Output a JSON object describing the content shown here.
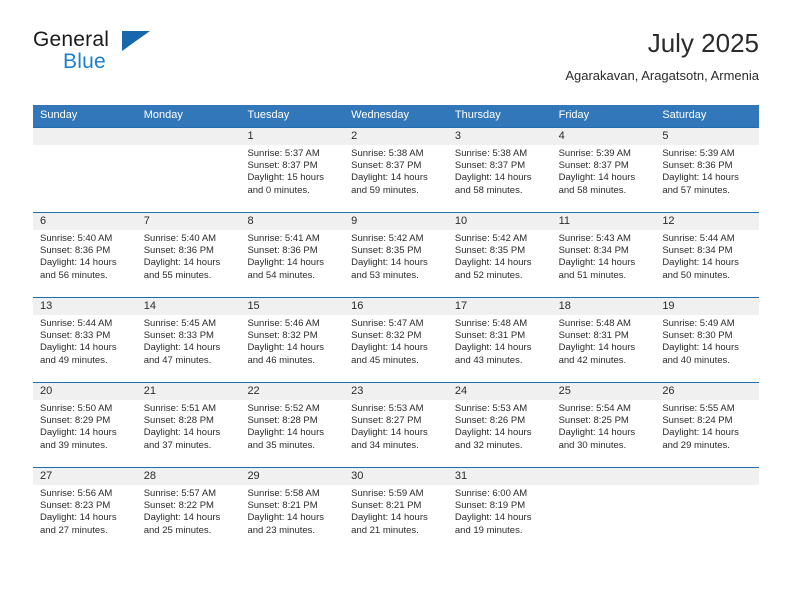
{
  "brand": {
    "name_top": "General",
    "name_bottom": "Blue",
    "triangle_color": "#1866ab",
    "blue_color": "#1d7fd0"
  },
  "header": {
    "title": "July 2025",
    "subtitle": "Agarakavan, Aragatsotn, Armenia"
  },
  "theme": {
    "header_blue": "#3277b9",
    "row_border_blue": "#1f6cb0",
    "day_band_gray": "#f0f0f0"
  },
  "calendar": {
    "weekdays": [
      "Sunday",
      "Monday",
      "Tuesday",
      "Wednesday",
      "Thursday",
      "Friday",
      "Saturday"
    ],
    "weeks": [
      [
        {
          "day": "",
          "sunrise": "",
          "sunset": "",
          "daylight_1": "",
          "daylight_2": ""
        },
        {
          "day": "",
          "sunrise": "",
          "sunset": "",
          "daylight_1": "",
          "daylight_2": ""
        },
        {
          "day": "1",
          "sunrise": "Sunrise: 5:37 AM",
          "sunset": "Sunset: 8:37 PM",
          "daylight_1": "Daylight: 15 hours",
          "daylight_2": "and 0 minutes."
        },
        {
          "day": "2",
          "sunrise": "Sunrise: 5:38 AM",
          "sunset": "Sunset: 8:37 PM",
          "daylight_1": "Daylight: 14 hours",
          "daylight_2": "and 59 minutes."
        },
        {
          "day": "3",
          "sunrise": "Sunrise: 5:38 AM",
          "sunset": "Sunset: 8:37 PM",
          "daylight_1": "Daylight: 14 hours",
          "daylight_2": "and 58 minutes."
        },
        {
          "day": "4",
          "sunrise": "Sunrise: 5:39 AM",
          "sunset": "Sunset: 8:37 PM",
          "daylight_1": "Daylight: 14 hours",
          "daylight_2": "and 58 minutes."
        },
        {
          "day": "5",
          "sunrise": "Sunrise: 5:39 AM",
          "sunset": "Sunset: 8:36 PM",
          "daylight_1": "Daylight: 14 hours",
          "daylight_2": "and 57 minutes."
        }
      ],
      [
        {
          "day": "6",
          "sunrise": "Sunrise: 5:40 AM",
          "sunset": "Sunset: 8:36 PM",
          "daylight_1": "Daylight: 14 hours",
          "daylight_2": "and 56 minutes."
        },
        {
          "day": "7",
          "sunrise": "Sunrise: 5:40 AM",
          "sunset": "Sunset: 8:36 PM",
          "daylight_1": "Daylight: 14 hours",
          "daylight_2": "and 55 minutes."
        },
        {
          "day": "8",
          "sunrise": "Sunrise: 5:41 AM",
          "sunset": "Sunset: 8:36 PM",
          "daylight_1": "Daylight: 14 hours",
          "daylight_2": "and 54 minutes."
        },
        {
          "day": "9",
          "sunrise": "Sunrise: 5:42 AM",
          "sunset": "Sunset: 8:35 PM",
          "daylight_1": "Daylight: 14 hours",
          "daylight_2": "and 53 minutes."
        },
        {
          "day": "10",
          "sunrise": "Sunrise: 5:42 AM",
          "sunset": "Sunset: 8:35 PM",
          "daylight_1": "Daylight: 14 hours",
          "daylight_2": "and 52 minutes."
        },
        {
          "day": "11",
          "sunrise": "Sunrise: 5:43 AM",
          "sunset": "Sunset: 8:34 PM",
          "daylight_1": "Daylight: 14 hours",
          "daylight_2": "and 51 minutes."
        },
        {
          "day": "12",
          "sunrise": "Sunrise: 5:44 AM",
          "sunset": "Sunset: 8:34 PM",
          "daylight_1": "Daylight: 14 hours",
          "daylight_2": "and 50 minutes."
        }
      ],
      [
        {
          "day": "13",
          "sunrise": "Sunrise: 5:44 AM",
          "sunset": "Sunset: 8:33 PM",
          "daylight_1": "Daylight: 14 hours",
          "daylight_2": "and 49 minutes."
        },
        {
          "day": "14",
          "sunrise": "Sunrise: 5:45 AM",
          "sunset": "Sunset: 8:33 PM",
          "daylight_1": "Daylight: 14 hours",
          "daylight_2": "and 47 minutes."
        },
        {
          "day": "15",
          "sunrise": "Sunrise: 5:46 AM",
          "sunset": "Sunset: 8:32 PM",
          "daylight_1": "Daylight: 14 hours",
          "daylight_2": "and 46 minutes."
        },
        {
          "day": "16",
          "sunrise": "Sunrise: 5:47 AM",
          "sunset": "Sunset: 8:32 PM",
          "daylight_1": "Daylight: 14 hours",
          "daylight_2": "and 45 minutes."
        },
        {
          "day": "17",
          "sunrise": "Sunrise: 5:48 AM",
          "sunset": "Sunset: 8:31 PM",
          "daylight_1": "Daylight: 14 hours",
          "daylight_2": "and 43 minutes."
        },
        {
          "day": "18",
          "sunrise": "Sunrise: 5:48 AM",
          "sunset": "Sunset: 8:31 PM",
          "daylight_1": "Daylight: 14 hours",
          "daylight_2": "and 42 minutes."
        },
        {
          "day": "19",
          "sunrise": "Sunrise: 5:49 AM",
          "sunset": "Sunset: 8:30 PM",
          "daylight_1": "Daylight: 14 hours",
          "daylight_2": "and 40 minutes."
        }
      ],
      [
        {
          "day": "20",
          "sunrise": "Sunrise: 5:50 AM",
          "sunset": "Sunset: 8:29 PM",
          "daylight_1": "Daylight: 14 hours",
          "daylight_2": "and 39 minutes."
        },
        {
          "day": "21",
          "sunrise": "Sunrise: 5:51 AM",
          "sunset": "Sunset: 8:28 PM",
          "daylight_1": "Daylight: 14 hours",
          "daylight_2": "and 37 minutes."
        },
        {
          "day": "22",
          "sunrise": "Sunrise: 5:52 AM",
          "sunset": "Sunset: 8:28 PM",
          "daylight_1": "Daylight: 14 hours",
          "daylight_2": "and 35 minutes."
        },
        {
          "day": "23",
          "sunrise": "Sunrise: 5:53 AM",
          "sunset": "Sunset: 8:27 PM",
          "daylight_1": "Daylight: 14 hours",
          "daylight_2": "and 34 minutes."
        },
        {
          "day": "24",
          "sunrise": "Sunrise: 5:53 AM",
          "sunset": "Sunset: 8:26 PM",
          "daylight_1": "Daylight: 14 hours",
          "daylight_2": "and 32 minutes."
        },
        {
          "day": "25",
          "sunrise": "Sunrise: 5:54 AM",
          "sunset": "Sunset: 8:25 PM",
          "daylight_1": "Daylight: 14 hours",
          "daylight_2": "and 30 minutes."
        },
        {
          "day": "26",
          "sunrise": "Sunrise: 5:55 AM",
          "sunset": "Sunset: 8:24 PM",
          "daylight_1": "Daylight: 14 hours",
          "daylight_2": "and 29 minutes."
        }
      ],
      [
        {
          "day": "27",
          "sunrise": "Sunrise: 5:56 AM",
          "sunset": "Sunset: 8:23 PM",
          "daylight_1": "Daylight: 14 hours",
          "daylight_2": "and 27 minutes."
        },
        {
          "day": "28",
          "sunrise": "Sunrise: 5:57 AM",
          "sunset": "Sunset: 8:22 PM",
          "daylight_1": "Daylight: 14 hours",
          "daylight_2": "and 25 minutes."
        },
        {
          "day": "29",
          "sunrise": "Sunrise: 5:58 AM",
          "sunset": "Sunset: 8:21 PM",
          "daylight_1": "Daylight: 14 hours",
          "daylight_2": "and 23 minutes."
        },
        {
          "day": "30",
          "sunrise": "Sunrise: 5:59 AM",
          "sunset": "Sunset: 8:21 PM",
          "daylight_1": "Daylight: 14 hours",
          "daylight_2": "and 21 minutes."
        },
        {
          "day": "31",
          "sunrise": "Sunrise: 6:00 AM",
          "sunset": "Sunset: 8:19 PM",
          "daylight_1": "Daylight: 14 hours",
          "daylight_2": "and 19 minutes."
        },
        {
          "day": "",
          "sunrise": "",
          "sunset": "",
          "daylight_1": "",
          "daylight_2": ""
        },
        {
          "day": "",
          "sunrise": "",
          "sunset": "",
          "daylight_1": "",
          "daylight_2": ""
        }
      ]
    ]
  }
}
